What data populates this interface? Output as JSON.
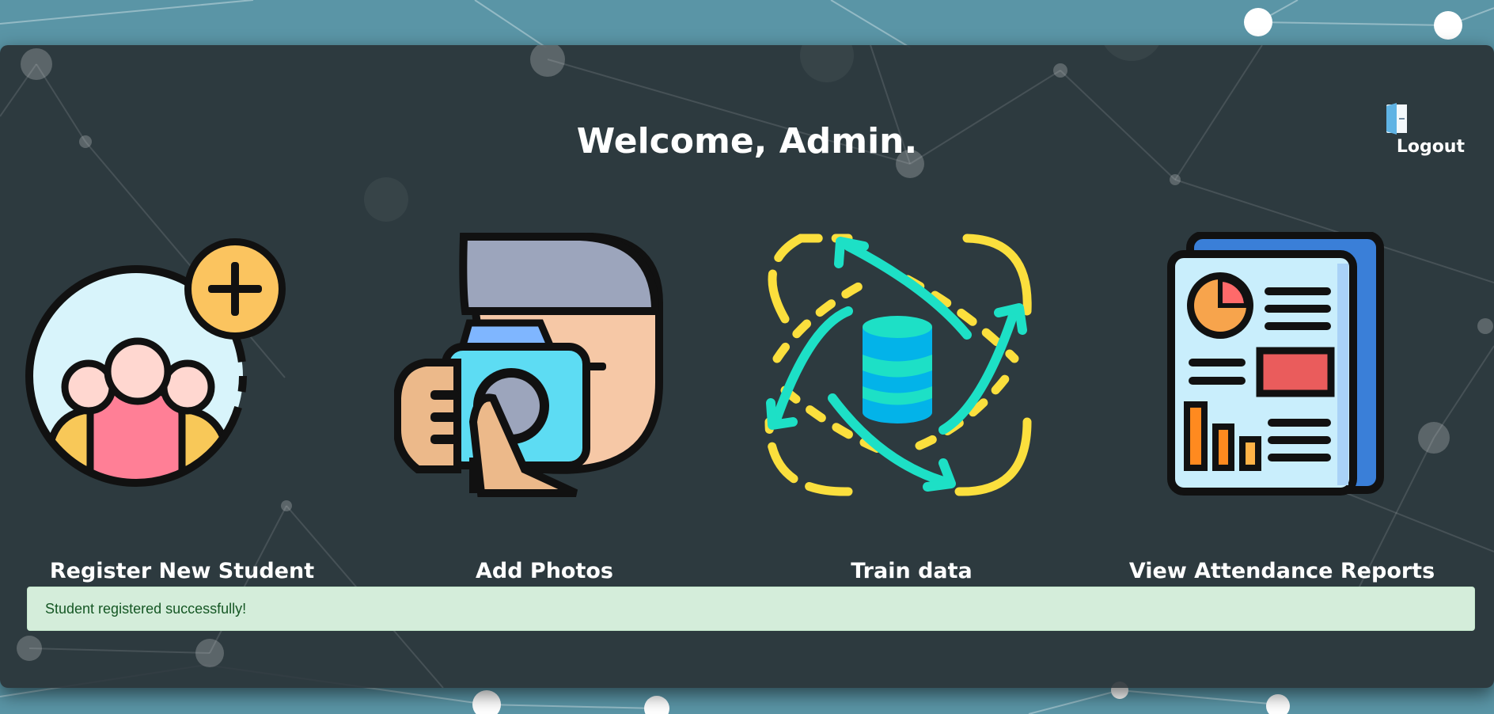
{
  "header": {
    "logout_label": "Logout",
    "logout_icon": "door-exit-icon"
  },
  "main": {
    "title": "Welcome, Admin."
  },
  "cards": [
    {
      "label": "Register New Student",
      "icon": "add-group-icon"
    },
    {
      "label": "Add Photos",
      "icon": "photographer-camera-icon"
    },
    {
      "label": "Train data",
      "icon": "database-sync-icon"
    },
    {
      "label": "View Attendance Reports",
      "icon": "report-document-icon"
    }
  ],
  "alert": {
    "message": "Student registered successfully!",
    "type": "success"
  },
  "colors": {
    "panel": "#283034",
    "background": "#5d98a8",
    "alert_bg": "#d4edda",
    "alert_text": "#155724"
  }
}
